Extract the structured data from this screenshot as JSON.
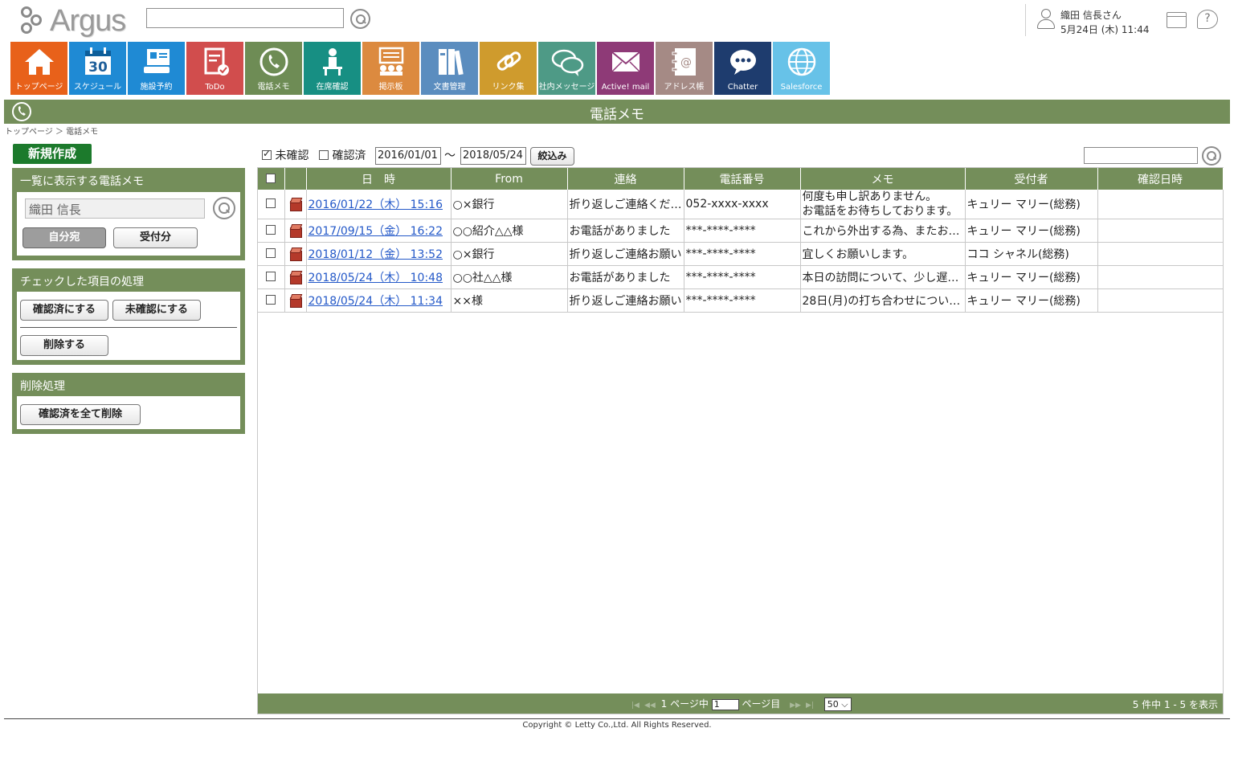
{
  "header": {
    "logo_text": "Argus",
    "search_value": "",
    "user_name": "織田 信長さん",
    "datetime": "5月24日 (木) 11:44",
    "help": "?"
  },
  "tiles": [
    {
      "label": "トップページ",
      "icon": "home-icon",
      "color": "#e8611a"
    },
    {
      "label": "スケジュール",
      "icon": "calendar-icon",
      "color": "#1f8ad4",
      "number": "30"
    },
    {
      "label": "施設予約",
      "icon": "facility-icon",
      "color": "#1f8ad4"
    },
    {
      "label": "ToDo",
      "icon": "todo-icon",
      "color": "#d14d4d"
    },
    {
      "label": "電話メモ",
      "icon": "phone-icon",
      "color": "#6e8c55"
    },
    {
      "label": "在席確認",
      "icon": "attendance-icon",
      "color": "#178f83"
    },
    {
      "label": "掲示板",
      "icon": "bulletin-icon",
      "color": "#dc8a3f"
    },
    {
      "label": "文書管理",
      "icon": "document-icon",
      "color": "#5b8dbf"
    },
    {
      "label": "リンク集",
      "icon": "link-icon",
      "color": "#cf9b2d"
    },
    {
      "label": "社内メッセージ",
      "icon": "message-icon",
      "color": "#4e9a86"
    },
    {
      "label": "Active! mail",
      "icon": "mail-icon",
      "color": "#8e3a77"
    },
    {
      "label": "アドレス帳",
      "icon": "addressbook-icon",
      "color": "#a58a85"
    },
    {
      "label": "Chatter",
      "icon": "chatter-icon",
      "color": "#1e3c6e"
    },
    {
      "label": "Salesforce",
      "icon": "globe-icon",
      "color": "#67c2e8"
    }
  ],
  "page": {
    "title": "電話メモ",
    "breadcrumb": "トップページ ＞ 電話メモ"
  },
  "sidebar": {
    "new_button": "新規作成",
    "list_panel": {
      "title": "一覧に表示する電話メモ",
      "name_value": "織田 信長",
      "btn_mine": "自分宛",
      "btn_received": "受付分"
    },
    "checked_panel": {
      "title": "チェックした項目の処理",
      "btn_confirmed": "確認済にする",
      "btn_unconfirmed": "未確認にする",
      "btn_delete": "削除する"
    },
    "delete_panel": {
      "title": "削除処理",
      "btn_delete_all": "確認済を全て削除"
    }
  },
  "filter": {
    "unconfirmed_label": "未確認",
    "unconfirmed_checked": true,
    "confirmed_label": "確認済",
    "confirmed_checked": false,
    "date_from": "2016/01/01",
    "tilde": "〜",
    "date_to": "2018/05/24",
    "filter_button": "絞込み",
    "search_value": ""
  },
  "table": {
    "headers": {
      "datetime": "日　時",
      "from": "From",
      "contact": "連絡",
      "phone": "電話番号",
      "memo": "メモ",
      "receiver": "受付者",
      "confirmed_at": "確認日時"
    },
    "rows": [
      {
        "datetime": "2016/01/22（木） 15:16",
        "from": "○×銀行",
        "contact": "折り返しご連絡ください",
        "phone": "052-xxxx-xxxx",
        "memo": "何度も申し訳ありません。",
        "memo2": "お電話をお待ちしております。",
        "receiver": "キュリー マリー(総務)",
        "confirmed_at": ""
      },
      {
        "datetime": "2017/09/15（金） 16:22",
        "from": "○○紹介△△様",
        "contact": "お電話がありました",
        "phone": "***-****-****",
        "memo": "これから外出する為、またお…",
        "memo2": "",
        "receiver": "キュリー マリー(総務)",
        "confirmed_at": ""
      },
      {
        "datetime": "2018/01/12（金） 13:52",
        "from": "○×銀行",
        "contact": "折り返しご連絡お願い",
        "phone": "***-****-****",
        "memo": "宜しくお願いします。",
        "memo2": "",
        "receiver": "ココ シャネル(総務)",
        "confirmed_at": ""
      },
      {
        "datetime": "2018/05/24（木） 10:48",
        "from": "○○社△△様",
        "contact": "お電話がありました",
        "phone": "***-****-****",
        "memo": "本日の訪問について、少し遅…",
        "memo2": "",
        "receiver": "キュリー マリー(総務)",
        "confirmed_at": ""
      },
      {
        "datetime": "2018/05/24（木） 11:34",
        "from": "××様",
        "contact": "折り返しご連絡お願い",
        "phone": "***-****-****",
        "memo": "28日(月)の打ち合わせについ…",
        "memo2": "",
        "receiver": "キュリー マリー(総務)",
        "confirmed_at": ""
      }
    ]
  },
  "pager": {
    "page_prefix": "1 ページ中",
    "page_value": "1",
    "page_suffix": "ページ目",
    "per_page": "50",
    "summary": "5 件中 1 - 5 を表示"
  },
  "footer": {
    "copyright": "Copyright © Letty Co.,Ltd. All Rights Reserved."
  }
}
